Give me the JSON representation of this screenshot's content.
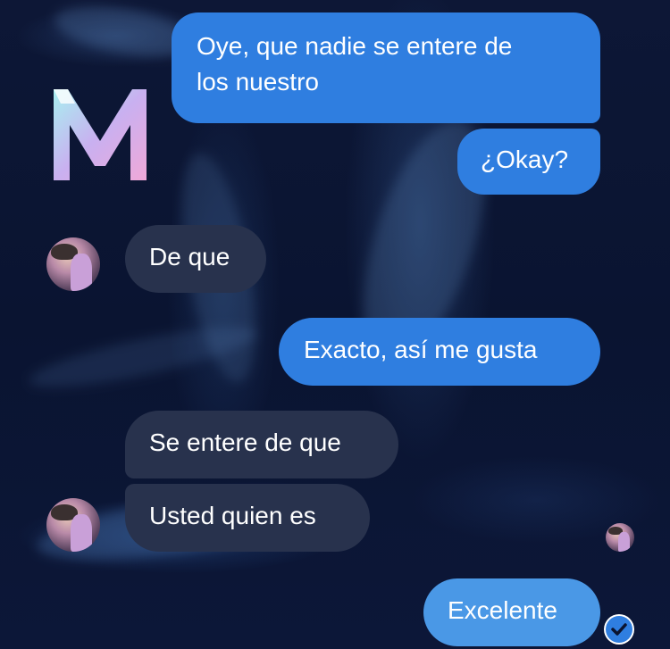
{
  "app": {
    "logo_letter": "M"
  },
  "colors": {
    "outgoing_bubble": "#2f7ee0",
    "incoming_bubble": "#28324d",
    "background": "#0b1430",
    "read_check": "#2f7ee0"
  },
  "messages": [
    {
      "side": "outgoing",
      "text_lines": [
        "Oye, que nadie se entere de",
        "los nuestro"
      ]
    },
    {
      "side": "outgoing",
      "text": "¿Okay?"
    },
    {
      "side": "incoming",
      "text": "De que"
    },
    {
      "side": "outgoing",
      "text": "Exacto, así me gusta"
    },
    {
      "side": "incoming",
      "text": "Se entere de que"
    },
    {
      "side": "incoming",
      "text": "Usted quien es"
    },
    {
      "side": "outgoing",
      "text": "Excelente",
      "status_icon": "check-circle-icon"
    }
  ]
}
